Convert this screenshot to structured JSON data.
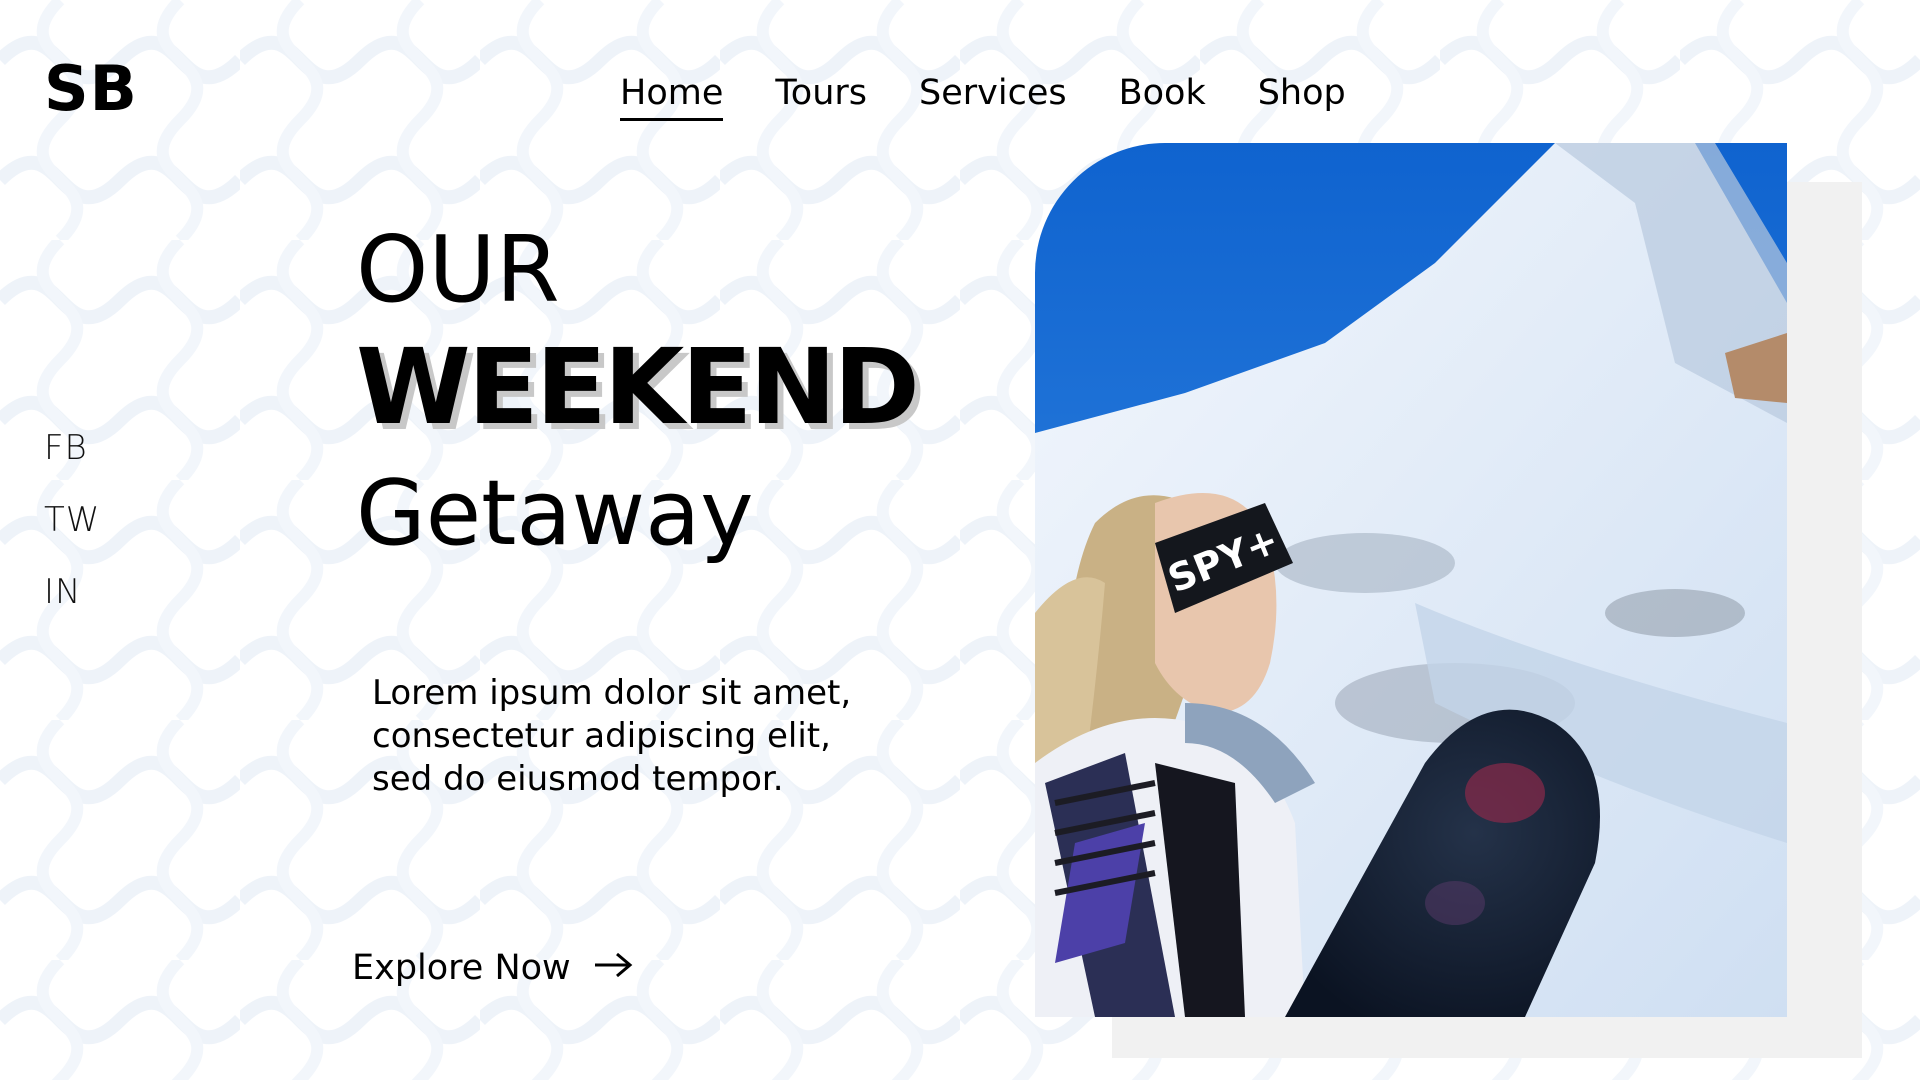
{
  "logo": {
    "text": "SB"
  },
  "nav": {
    "items": [
      {
        "label": "Home",
        "active": true
      },
      {
        "label": "Tours",
        "active": false
      },
      {
        "label": "Services",
        "active": false
      },
      {
        "label": "Book",
        "active": false
      },
      {
        "label": "Shop",
        "active": false
      }
    ]
  },
  "social": {
    "items": [
      {
        "label": "FB"
      },
      {
        "label": "TW"
      },
      {
        "label": "IN"
      }
    ]
  },
  "hero": {
    "line1": "OUR",
    "line2": "WEEKEND",
    "line3": "Getaway",
    "description": "Lorem ipsum dolor sit amet, consectetur adipiscing elit, sed do eiusmod tempor."
  },
  "cta": {
    "label": "Explore Now",
    "icon": "arrow-right-icon"
  },
  "photo": {
    "subject": "snowboarder-with-mountain-photo",
    "goggle_strap_text": "SPY+"
  },
  "colors": {
    "text": "#000000",
    "background": "#ffffff",
    "pattern": "#eef3f9",
    "sky": "#1f73d6",
    "snow": "#eef4fb"
  }
}
